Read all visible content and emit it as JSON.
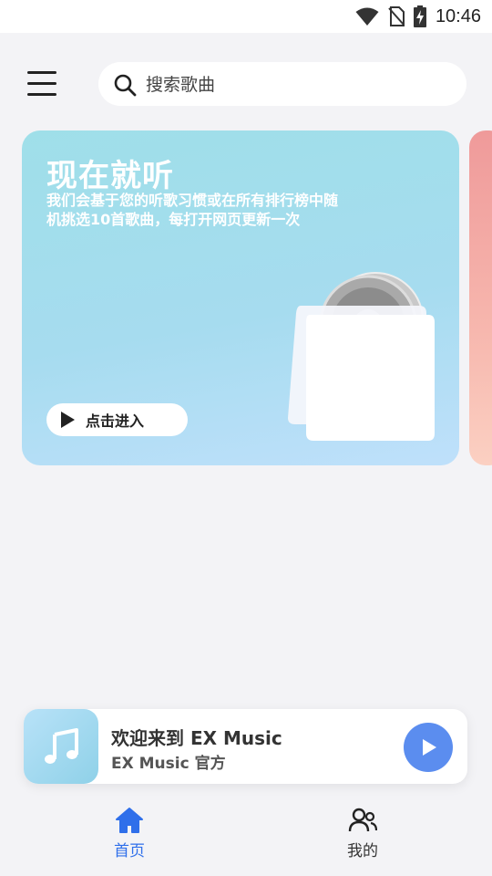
{
  "status_bar": {
    "time": "10:46",
    "icons": [
      "wifi-icon",
      "no-sim-icon",
      "battery-charging-icon"
    ]
  },
  "top_bar": {
    "menu_icon": "hamburger-menu-icon",
    "search": {
      "placeholder": "搜索歌曲",
      "icon": "search-icon",
      "value": ""
    }
  },
  "banner": {
    "title": "现在就听",
    "description": "我们会基于您的听歌习惯或在所有排行榜中随机挑选10首歌曲，每打开网页更新一次",
    "button_label": "点击进入",
    "button_icon": "play-icon",
    "art_icon": "record-bag-icon",
    "colors": {
      "start": "#9fdfe9",
      "end": "#bfe0fb",
      "next_card": "#ef9a9a"
    }
  },
  "player": {
    "title": "欢迎来到 EX Music",
    "subtitle": "EX Music 官方",
    "cover_icon": "music-note-icon",
    "play_icon": "play-icon",
    "accent": "#5b8def"
  },
  "bottom_nav": {
    "items": [
      {
        "label": "首页",
        "icon": "home-icon",
        "active": true
      },
      {
        "label": "我的",
        "icon": "user-group-icon",
        "active": false
      }
    ],
    "active_color": "#2f6fea"
  }
}
